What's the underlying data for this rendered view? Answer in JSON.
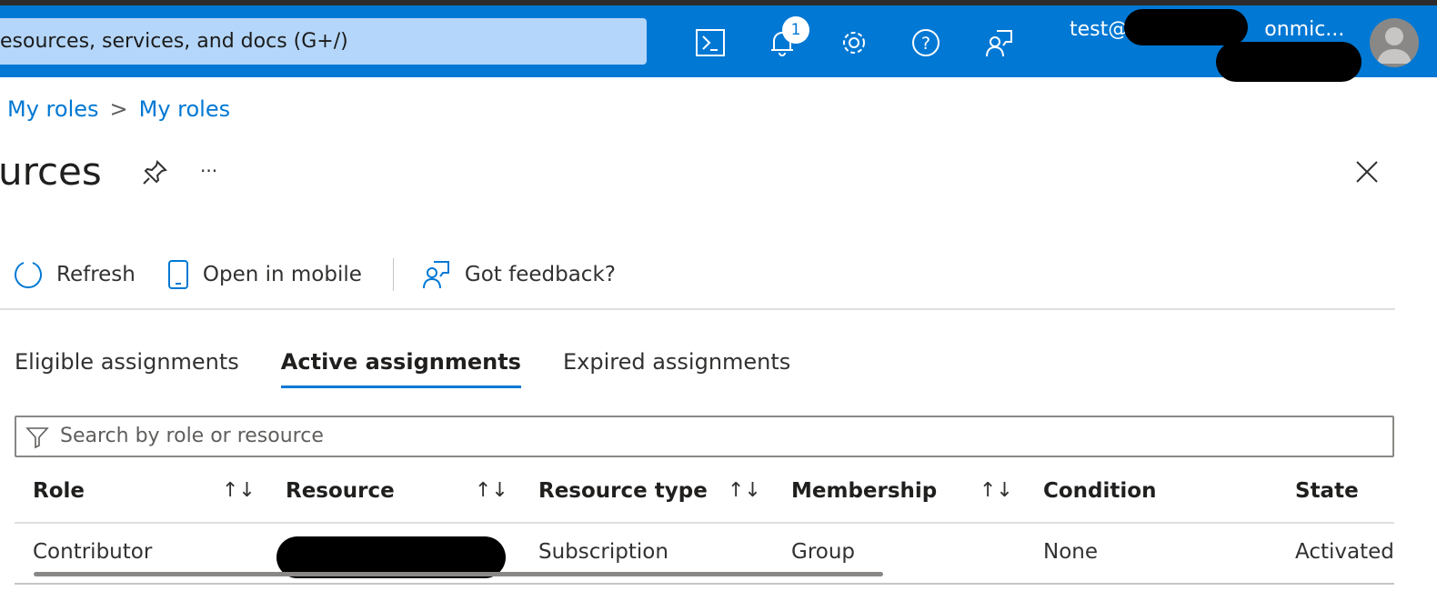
{
  "header": {
    "search_placeholder": "esources, services, and docs (G+/)",
    "notification_count": "1",
    "user": "test@",
    "user_suffix": "onmic...",
    "icons": [
      "cloud-shell-icon",
      "notifications-icon",
      "settings-icon",
      "help-icon",
      "feedback-icon"
    ]
  },
  "breadcrumb": [
    "My roles",
    "My roles"
  ],
  "page": {
    "title": "urces",
    "more": "···"
  },
  "toolbar": {
    "refresh": "Refresh",
    "open_mobile": "Open in mobile",
    "feedback": "Got feedback?"
  },
  "tabs": [
    {
      "label": "Eligible assignments"
    },
    {
      "label": "Active assignments",
      "active": true
    },
    {
      "label": "Expired assignments"
    }
  ],
  "filter": {
    "placeholder": "Search by role or resource"
  },
  "table": {
    "columns": [
      "Role",
      "Resource",
      "Resource type",
      "Membership",
      "Condition",
      "State"
    ],
    "sort_glyph": "↑↓",
    "rows": [
      {
        "role": "Contributor",
        "resource": "",
        "type": "Subscription",
        "membership": "Group",
        "condition": "None",
        "state": "Activated"
      }
    ]
  },
  "colors": {
    "accent": "#0078d4"
  }
}
